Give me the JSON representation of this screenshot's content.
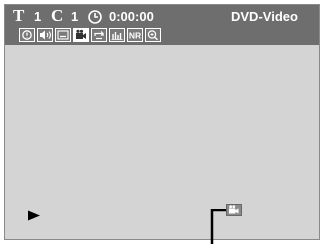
{
  "status": {
    "title_letter": "T",
    "title_number": "1",
    "chapter_letter": "C",
    "chapter_number": "1",
    "time": "0:00:00",
    "disc_type": "DVD-Video"
  },
  "icons": [
    {
      "name": "search-icon",
      "active": false
    },
    {
      "name": "audio-icon",
      "active": false
    },
    {
      "name": "subtitle-icon",
      "active": false
    },
    {
      "name": "camera-angle-icon",
      "active": true
    },
    {
      "name": "repeat-icon",
      "active": false
    },
    {
      "name": "equalizer-icon",
      "active": false
    },
    {
      "name": "noise-reduction-icon",
      "active": false,
      "label": "NR"
    },
    {
      "name": "zoom-icon",
      "active": false
    }
  ],
  "colors": {
    "status_bar": "#6e6e6e",
    "screen": "#d4d4d4",
    "text": "#ffffff"
  }
}
